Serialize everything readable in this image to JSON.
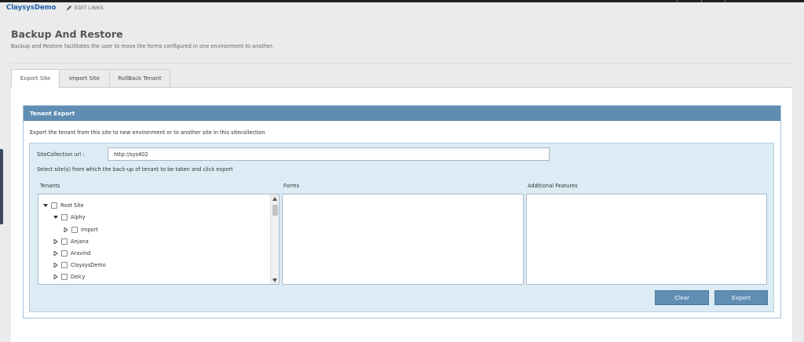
{
  "nav": {
    "brand": "ClaysysDemo",
    "edit_links": "EDIT LINKS"
  },
  "page": {
    "title": "Backup And Restore",
    "description": "Backup and Restore facilitates the user to move the forms configured in one environment to another."
  },
  "tabs": [
    {
      "label": "Export Site",
      "active": true
    },
    {
      "label": "Import Site",
      "active": false
    },
    {
      "label": "RollBack Tenant",
      "active": false
    }
  ],
  "panel": {
    "title": "Tenant Export",
    "description": "Export the tenant from this site to new environment or to another site in this sitecollection",
    "url_label": "SiteCollection url :",
    "url_value": "http://sys402",
    "select_hint": "Select site(s) from which the back-up of tenant to be taken and click export",
    "columns": {
      "tenants": "Tenants",
      "forms": "Forms",
      "features": "Additional Features"
    },
    "tree": [
      {
        "label": "Root Site",
        "level": 0,
        "expanded": true
      },
      {
        "label": "Alphy",
        "level": 1,
        "expanded": true
      },
      {
        "label": "Import",
        "level": 2,
        "expanded": false
      },
      {
        "label": "Anjana",
        "level": 1,
        "expanded": false
      },
      {
        "label": "Aravind",
        "level": 1,
        "expanded": false
      },
      {
        "label": "ClaysysDemo",
        "level": 1,
        "expanded": false
      },
      {
        "label": "Delcy",
        "level": 1,
        "expanded": false
      }
    ],
    "buttons": {
      "clear": "Clear",
      "export": "Export"
    }
  },
  "colors": {
    "brand": "#1c5fa6",
    "panel_header": "#5f8db4",
    "inner_bg": "#ddebf5"
  }
}
